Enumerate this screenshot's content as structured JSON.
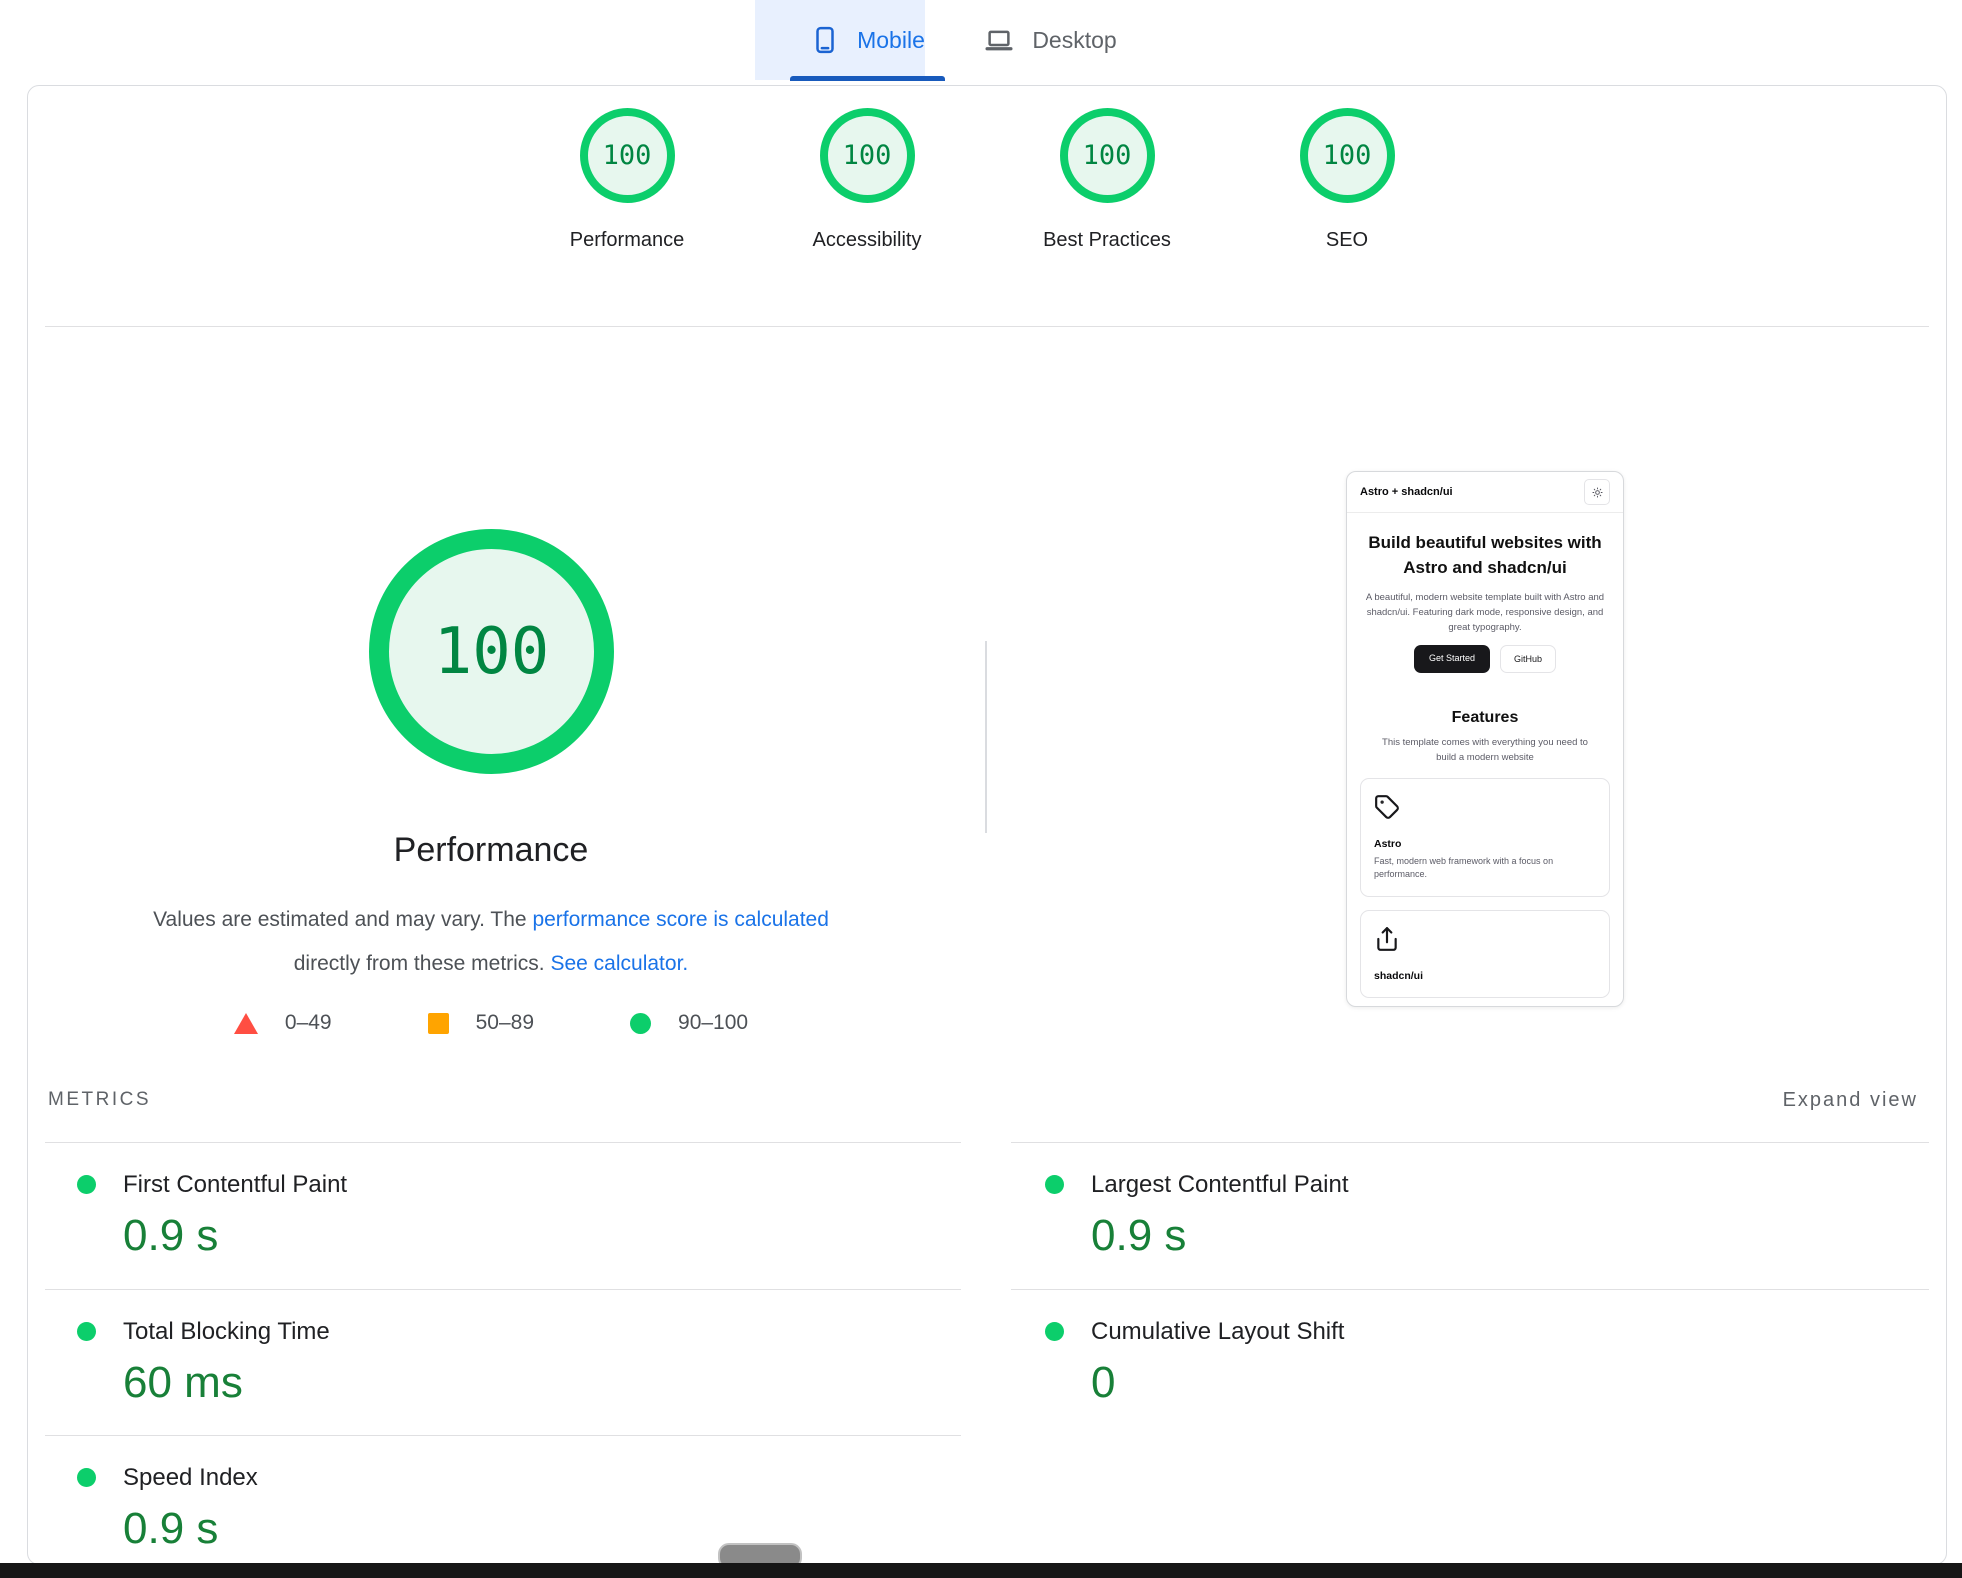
{
  "device_tabs": {
    "mobile_label": "Mobile",
    "desktop_label": "Desktop"
  },
  "category_scores": {
    "performance": {
      "label": "Performance",
      "score": "100"
    },
    "accessibility": {
      "label": "Accessibility",
      "score": "100"
    },
    "best_practices": {
      "label": "Best Practices",
      "score": "100"
    },
    "seo": {
      "label": "SEO",
      "score": "100"
    }
  },
  "performance_section": {
    "gauge_score": "100",
    "title": "Performance",
    "disclaimer": {
      "prefix": "Values are estimated and may vary. The ",
      "calc_link": "performance score is calculated",
      "middle": "directly from these metrics. ",
      "calculator_link": "See calculator."
    },
    "legend": {
      "fail_range": "0–49",
      "average_range": "50–89",
      "pass_range": "90–100"
    }
  },
  "metrics_section": {
    "heading": "METRICS",
    "expand_label": "Expand view",
    "left": [
      {
        "name": "First Contentful Paint",
        "value": "0.9 s"
      },
      {
        "name": "Total Blocking Time",
        "value": "60 ms"
      },
      {
        "name": "Speed Index",
        "value": "0.9 s"
      }
    ],
    "right": [
      {
        "name": "Largest Contentful Paint",
        "value": "0.9 s"
      },
      {
        "name": "Cumulative Layout Shift",
        "value": "0"
      }
    ]
  },
  "page_preview": {
    "site_title": "Astro + shadcn/ui",
    "hero_title": "Build beautiful websites with Astro and shadcn/ui",
    "hero_text": "A beautiful, modern website template built with Astro and shadcn/ui. Featuring dark mode, responsive design, and great typography.",
    "get_started_label": "Get Started",
    "github_label": "GitHub",
    "features_title": "Features",
    "features_text": "This template comes with everything you need to build a modern website",
    "feature1": {
      "name": "Astro",
      "desc": "Fast, modern web framework with a focus on performance."
    },
    "feature2": {
      "name": "shadcn/ui"
    }
  },
  "colors": {
    "accent_blue": "#1a73e8",
    "tab_underline_blue": "#185abc",
    "pass_green": "#0cce6b",
    "score_text_green": "#018642",
    "metric_value_green": "#188038",
    "fail_red": "#ff4e42",
    "average_orange": "#ffa400"
  }
}
